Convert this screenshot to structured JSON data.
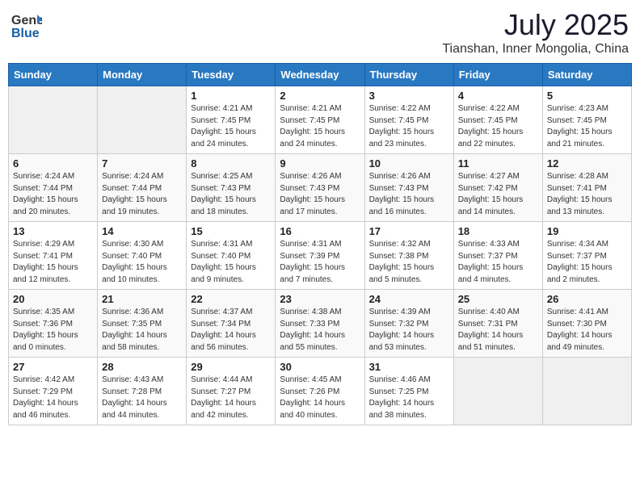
{
  "header": {
    "logo_general": "General",
    "logo_blue": "Blue",
    "title": "July 2025",
    "subtitle": "Tianshan, Inner Mongolia, China"
  },
  "calendar": {
    "days_of_week": [
      "Sunday",
      "Monday",
      "Tuesday",
      "Wednesday",
      "Thursday",
      "Friday",
      "Saturday"
    ],
    "weeks": [
      [
        {
          "day": "",
          "info": ""
        },
        {
          "day": "",
          "info": ""
        },
        {
          "day": "1",
          "info": "Sunrise: 4:21 AM\nSunset: 7:45 PM\nDaylight: 15 hours\nand 24 minutes."
        },
        {
          "day": "2",
          "info": "Sunrise: 4:21 AM\nSunset: 7:45 PM\nDaylight: 15 hours\nand 24 minutes."
        },
        {
          "day": "3",
          "info": "Sunrise: 4:22 AM\nSunset: 7:45 PM\nDaylight: 15 hours\nand 23 minutes."
        },
        {
          "day": "4",
          "info": "Sunrise: 4:22 AM\nSunset: 7:45 PM\nDaylight: 15 hours\nand 22 minutes."
        },
        {
          "day": "5",
          "info": "Sunrise: 4:23 AM\nSunset: 7:45 PM\nDaylight: 15 hours\nand 21 minutes."
        }
      ],
      [
        {
          "day": "6",
          "info": "Sunrise: 4:24 AM\nSunset: 7:44 PM\nDaylight: 15 hours\nand 20 minutes."
        },
        {
          "day": "7",
          "info": "Sunrise: 4:24 AM\nSunset: 7:44 PM\nDaylight: 15 hours\nand 19 minutes."
        },
        {
          "day": "8",
          "info": "Sunrise: 4:25 AM\nSunset: 7:43 PM\nDaylight: 15 hours\nand 18 minutes."
        },
        {
          "day": "9",
          "info": "Sunrise: 4:26 AM\nSunset: 7:43 PM\nDaylight: 15 hours\nand 17 minutes."
        },
        {
          "day": "10",
          "info": "Sunrise: 4:26 AM\nSunset: 7:43 PM\nDaylight: 15 hours\nand 16 minutes."
        },
        {
          "day": "11",
          "info": "Sunrise: 4:27 AM\nSunset: 7:42 PM\nDaylight: 15 hours\nand 14 minutes."
        },
        {
          "day": "12",
          "info": "Sunrise: 4:28 AM\nSunset: 7:41 PM\nDaylight: 15 hours\nand 13 minutes."
        }
      ],
      [
        {
          "day": "13",
          "info": "Sunrise: 4:29 AM\nSunset: 7:41 PM\nDaylight: 15 hours\nand 12 minutes."
        },
        {
          "day": "14",
          "info": "Sunrise: 4:30 AM\nSunset: 7:40 PM\nDaylight: 15 hours\nand 10 minutes."
        },
        {
          "day": "15",
          "info": "Sunrise: 4:31 AM\nSunset: 7:40 PM\nDaylight: 15 hours\nand 9 minutes."
        },
        {
          "day": "16",
          "info": "Sunrise: 4:31 AM\nSunset: 7:39 PM\nDaylight: 15 hours\nand 7 minutes."
        },
        {
          "day": "17",
          "info": "Sunrise: 4:32 AM\nSunset: 7:38 PM\nDaylight: 15 hours\nand 5 minutes."
        },
        {
          "day": "18",
          "info": "Sunrise: 4:33 AM\nSunset: 7:37 PM\nDaylight: 15 hours\nand 4 minutes."
        },
        {
          "day": "19",
          "info": "Sunrise: 4:34 AM\nSunset: 7:37 PM\nDaylight: 15 hours\nand 2 minutes."
        }
      ],
      [
        {
          "day": "20",
          "info": "Sunrise: 4:35 AM\nSunset: 7:36 PM\nDaylight: 15 hours\nand 0 minutes."
        },
        {
          "day": "21",
          "info": "Sunrise: 4:36 AM\nSunset: 7:35 PM\nDaylight: 14 hours\nand 58 minutes."
        },
        {
          "day": "22",
          "info": "Sunrise: 4:37 AM\nSunset: 7:34 PM\nDaylight: 14 hours\nand 56 minutes."
        },
        {
          "day": "23",
          "info": "Sunrise: 4:38 AM\nSunset: 7:33 PM\nDaylight: 14 hours\nand 55 minutes."
        },
        {
          "day": "24",
          "info": "Sunrise: 4:39 AM\nSunset: 7:32 PM\nDaylight: 14 hours\nand 53 minutes."
        },
        {
          "day": "25",
          "info": "Sunrise: 4:40 AM\nSunset: 7:31 PM\nDaylight: 14 hours\nand 51 minutes."
        },
        {
          "day": "26",
          "info": "Sunrise: 4:41 AM\nSunset: 7:30 PM\nDaylight: 14 hours\nand 49 minutes."
        }
      ],
      [
        {
          "day": "27",
          "info": "Sunrise: 4:42 AM\nSunset: 7:29 PM\nDaylight: 14 hours\nand 46 minutes."
        },
        {
          "day": "28",
          "info": "Sunrise: 4:43 AM\nSunset: 7:28 PM\nDaylight: 14 hours\nand 44 minutes."
        },
        {
          "day": "29",
          "info": "Sunrise: 4:44 AM\nSunset: 7:27 PM\nDaylight: 14 hours\nand 42 minutes."
        },
        {
          "day": "30",
          "info": "Sunrise: 4:45 AM\nSunset: 7:26 PM\nDaylight: 14 hours\nand 40 minutes."
        },
        {
          "day": "31",
          "info": "Sunrise: 4:46 AM\nSunset: 7:25 PM\nDaylight: 14 hours\nand 38 minutes."
        },
        {
          "day": "",
          "info": ""
        },
        {
          "day": "",
          "info": ""
        }
      ]
    ]
  }
}
